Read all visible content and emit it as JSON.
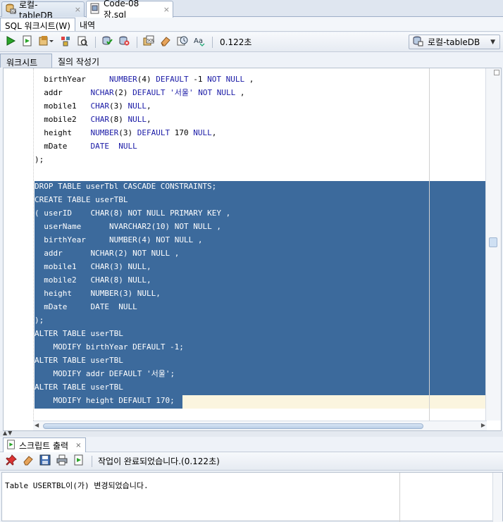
{
  "doc_tabs": [
    {
      "label": "로컬-tableDB",
      "active": false,
      "icon": "sql-connection-icon"
    },
    {
      "label": "Code-08장.sql",
      "active": true,
      "icon": "sql-file-icon"
    }
  ],
  "tab_close_glyph": "×",
  "sub_tabs": [
    {
      "label": "SQL 워크시트(W)",
      "active": true
    },
    {
      "label": "내역",
      "active": false
    }
  ],
  "toolbar": {
    "buttons": [
      "run-statement-icon",
      "run-script-icon",
      "autotrace-icon",
      "explain-plan-icon",
      "sql-tuning-icon",
      "commit-icon",
      "rollback-icon",
      "unshared-sql-icon",
      "clear-icon",
      "sql-history-icon",
      "format-case-icon"
    ],
    "elapsed": "0.122초",
    "connection": "로컬-tableDB"
  },
  "worksheet_tabs": [
    {
      "label": "워크시트",
      "active": true
    },
    {
      "label": "질의 작성기",
      "active": false
    }
  ],
  "editor": {
    "lines": [
      {
        "text": "  birthYear     NUMBER(4) DEFAULT -1 NOT NULL ,",
        "selected": false
      },
      {
        "text": "  addr      NCHAR(2) DEFAULT '서울' NOT NULL ,",
        "selected": false
      },
      {
        "text": "  mobile1   CHAR(3) NULL,",
        "selected": false
      },
      {
        "text": "  mobile2   CHAR(8) NULL,",
        "selected": false
      },
      {
        "text": "  height    NUMBER(3) DEFAULT 170 NULL,",
        "selected": false
      },
      {
        "text": "  mDate     DATE  NULL",
        "selected": false
      },
      {
        "text": ");",
        "selected": false
      },
      {
        "text": "",
        "selected": false
      },
      {
        "text": "DROP TABLE userTbl CASCADE CONSTRAINTS;",
        "selected": true
      },
      {
        "text": "CREATE TABLE userTBL",
        "selected": true
      },
      {
        "text": "( userID    CHAR(8) NOT NULL PRIMARY KEY ,",
        "selected": true
      },
      {
        "text": "  userName      NVARCHAR2(10) NOT NULL ,",
        "selected": true
      },
      {
        "text": "  birthYear     NUMBER(4) NOT NULL ,",
        "selected": true
      },
      {
        "text": "  addr      NCHAR(2) NOT NULL ,",
        "selected": true
      },
      {
        "text": "  mobile1   CHAR(3) NULL,",
        "selected": true
      },
      {
        "text": "  mobile2   CHAR(8) NULL,",
        "selected": true
      },
      {
        "text": "  height    NUMBER(3) NULL,",
        "selected": true
      },
      {
        "text": "  mDate     DATE  NULL",
        "selected": true
      },
      {
        "text": ");",
        "selected": true
      },
      {
        "text": "ALTER TABLE userTBL",
        "selected": true
      },
      {
        "text": "    MODIFY birthYear DEFAULT -1;",
        "selected": true
      },
      {
        "text": "ALTER TABLE userTBL",
        "selected": true
      },
      {
        "text": "    MODIFY addr DEFAULT '서울';",
        "selected": true
      },
      {
        "text": "ALTER TABLE userTBL",
        "selected": true
      },
      {
        "text": "    MODIFY height DEFAULT 170;",
        "selected": true
      }
    ],
    "keywords": [
      "NUMBER",
      "DEFAULT",
      "NOT",
      "NULL",
      "NCHAR",
      "CHAR",
      "DATE",
      "NVARCHAR2",
      "PRIMARY",
      "KEY"
    ]
  },
  "output": {
    "tab_label": "스크립트 출력",
    "status": "작업이 완료되었습니다.(0.122초)",
    "text": "Table USERTBL이(가) 변경되었습니다."
  },
  "colors": {
    "selection": "#3c6a9c",
    "keyword": "#1a1aa6",
    "current_line": "#fbf5df"
  }
}
